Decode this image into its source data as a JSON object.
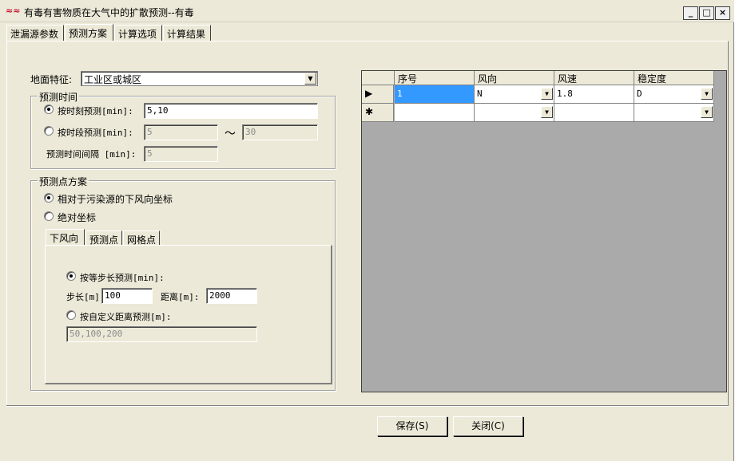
{
  "window": {
    "title": "有毒有害物质在大气中的扩散预测--有毒",
    "icon": "app-icon",
    "controls": {
      "minimize": "_",
      "maximize": "□",
      "close": "×"
    }
  },
  "tabs": [
    {
      "label": "泄漏源参数"
    },
    {
      "label": "预测方案"
    },
    {
      "label": "计算选项"
    },
    {
      "label": "计算结果"
    }
  ],
  "terrain": {
    "label": "地面特征:",
    "value": "工业区或城区"
  },
  "prediction_time": {
    "group_title": "预测时间",
    "moment_label": "按时刻预测[min]:",
    "moment_value": "5,10",
    "period_label": "按时段预测[min]:",
    "period_from": "5",
    "period_tilde": "～",
    "period_to": "30",
    "interval_label": "预测时间间隔 [min]:",
    "interval_value": "5"
  },
  "prediction_points": {
    "group_title": "预测点方案",
    "option_relative": "相对于污染源的下风向坐标",
    "option_absolute": "绝对坐标",
    "subtabs": [
      {
        "label": "下风向"
      },
      {
        "label": "预测点"
      },
      {
        "label": "网格点"
      }
    ],
    "equal_step_label": "按等步长预测[min]:",
    "step_label": "步长[m]:",
    "step_value": "100",
    "distance_label": "距离[m]:",
    "distance_value": "2000",
    "custom_label": "按自定义距离预测[m]:",
    "custom_value": "50,100,200"
  },
  "grid": {
    "columns": [
      "序号",
      "风向",
      "风速",
      "稳定度"
    ],
    "rows": [
      {
        "marker": "▶",
        "seq": "1",
        "wind_dir": "N",
        "wind_speed": "1.8",
        "stability": "D"
      },
      {
        "marker": "✱",
        "seq": "",
        "wind_dir": "",
        "wind_speed": "",
        "stability": ""
      }
    ]
  },
  "buttons": {
    "save": "保存(S)",
    "close": "关闭(C)"
  }
}
